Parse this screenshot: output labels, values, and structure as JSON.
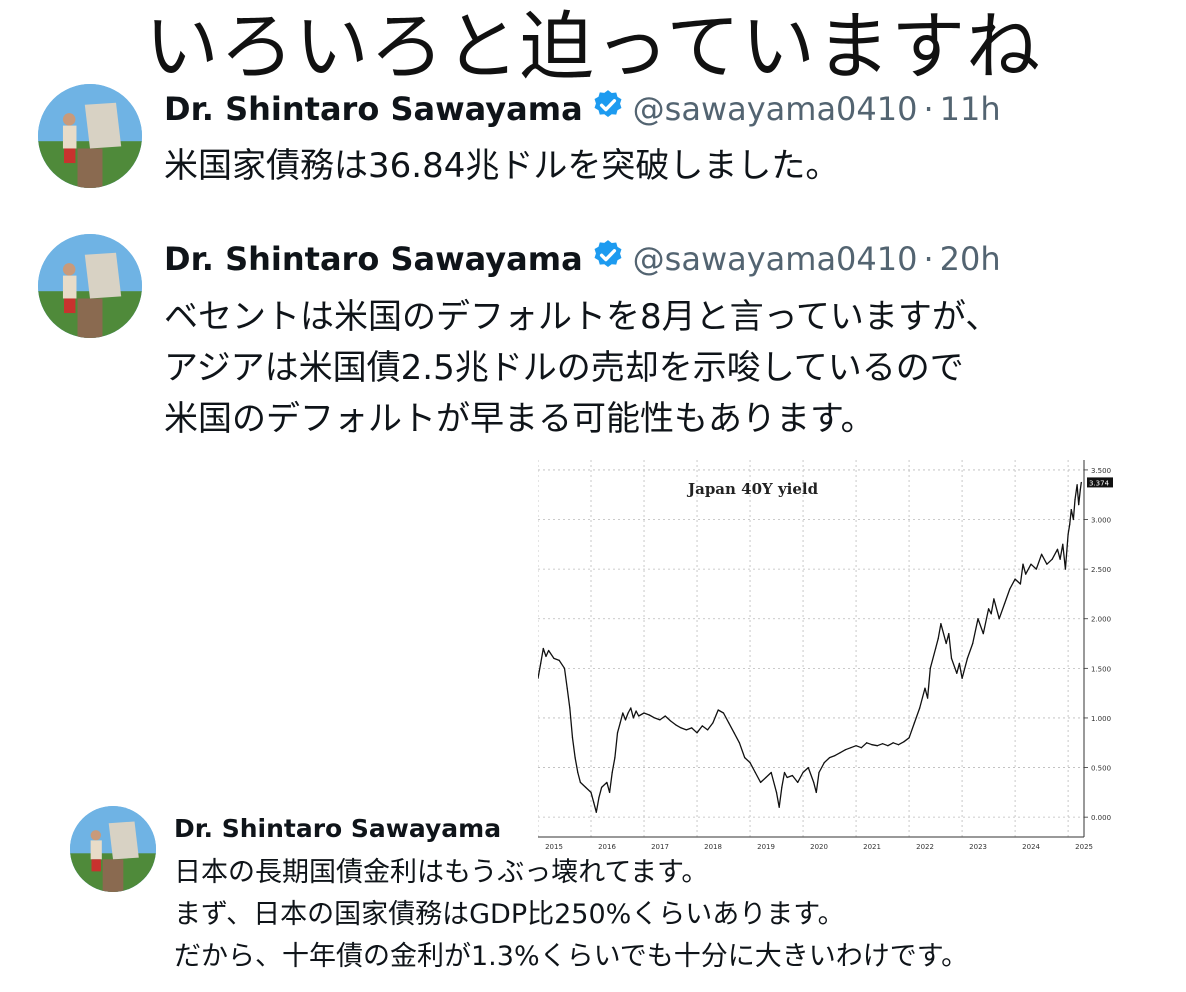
{
  "headline": "いろいろと迫っていますね",
  "tweets": [
    {
      "name": "Dr. Shintaro Sawayama",
      "handle": "@sawayama0410",
      "separator": "·",
      "time": "11h",
      "lines": [
        "米国家債務は36.84兆ドルを突破しました。"
      ]
    },
    {
      "name": "Dr. Shintaro Sawayama",
      "handle": "@sawayama0410",
      "separator": "·",
      "time": "20h",
      "lines": [
        "ベセントは米国のデフォルトを8月と言っていますが、",
        "アジアは米国債2.5兆ドルの売却を示唆しているので",
        "米国のデフォルトが早まる可能性もあります。"
      ]
    },
    {
      "name": "Dr. Shintaro Sawayama",
      "lines": [
        "日本の長期国債金利はもうぶっ壊れてます。",
        "まず、日本の国家債務はGDP比250%くらいあります。",
        "だから、十年債の金利が1.3%くらいでも十分に大きいわけです。"
      ]
    }
  ],
  "colors": {
    "verified": "#1d9bf0",
    "text": "#0f1419",
    "muted": "#536471",
    "line": "#111111"
  },
  "icons": {
    "verified": "verified-badge-icon",
    "avatar": "profile-photo"
  },
  "chart_data": {
    "type": "line",
    "title": "Japan 40Y yield",
    "xlabel": "",
    "ylabel": "",
    "x_ticks": [
      "2015",
      "2016",
      "2017",
      "2018",
      "2019",
      "2020",
      "2021",
      "2022",
      "2023",
      "2024",
      "2025"
    ],
    "y_ticks": [
      "0.000",
      "0.500",
      "1.000",
      "1.500",
      "2.000",
      "2.500",
      "3.000",
      "3.500"
    ],
    "ylim": [
      -0.2,
      3.6
    ],
    "xlim": [
      2015.0,
      2025.3
    ],
    "last_value_label": "3.374",
    "grid": true,
    "y_axis_side": "right",
    "series": [
      {
        "x": [
          2015.0,
          2015.05,
          2015.1,
          2015.15,
          2015.2,
          2015.3,
          2015.4,
          2015.5,
          2015.55,
          2015.6,
          2015.65,
          2015.7,
          2015.75,
          2015.8,
          2015.9,
          2016.0,
          2016.05,
          2016.1,
          2016.15,
          2016.2,
          2016.3,
          2016.35,
          2016.4,
          2016.45,
          2016.5,
          2016.55,
          2016.6,
          2016.65,
          2016.7,
          2016.75,
          2016.8,
          2016.85,
          2016.9,
          2017.0,
          2017.1,
          2017.2,
          2017.3,
          2017.4,
          2017.5,
          2017.6,
          2017.7,
          2017.8,
          2017.9,
          2018.0,
          2018.1,
          2018.2,
          2018.3,
          2018.4,
          2018.5,
          2018.6,
          2018.7,
          2018.8,
          2018.9,
          2019.0,
          2019.1,
          2019.2,
          2019.3,
          2019.4,
          2019.5,
          2019.55,
          2019.6,
          2019.65,
          2019.7,
          2019.8,
          2019.9,
          2020.0,
          2020.1,
          2020.2,
          2020.25,
          2020.3,
          2020.4,
          2020.5,
          2020.6,
          2020.7,
          2020.8,
          2020.9,
          2021.0,
          2021.1,
          2021.2,
          2021.3,
          2021.4,
          2021.5,
          2021.6,
          2021.7,
          2021.8,
          2021.9,
          2022.0,
          2022.1,
          2022.2,
          2022.3,
          2022.35,
          2022.4,
          2022.5,
          2022.55,
          2022.6,
          2022.7,
          2022.75,
          2022.8,
          2022.9,
          2022.95,
          2023.0,
          2023.1,
          2023.2,
          2023.3,
          2023.4,
          2023.5,
          2023.55,
          2023.6,
          2023.7,
          2023.8,
          2023.9,
          2024.0,
          2024.1,
          2024.15,
          2024.2,
          2024.3,
          2024.4,
          2024.5,
          2024.6,
          2024.7,
          2024.8,
          2024.85,
          2024.9,
          2024.95,
          2025.0,
          2025.03,
          2025.06,
          2025.1,
          2025.13,
          2025.17,
          2025.2,
          2025.23,
          2025.25
        ],
        "y": [
          1.4,
          1.55,
          1.7,
          1.62,
          1.68,
          1.6,
          1.58,
          1.5,
          1.3,
          1.1,
          0.8,
          0.6,
          0.45,
          0.35,
          0.3,
          0.25,
          0.15,
          0.05,
          0.2,
          0.3,
          0.35,
          0.25,
          0.45,
          0.6,
          0.85,
          0.95,
          1.05,
          0.98,
          1.05,
          1.1,
          1.0,
          1.07,
          1.02,
          1.05,
          1.03,
          1.0,
          0.98,
          1.02,
          0.97,
          0.93,
          0.9,
          0.88,
          0.9,
          0.85,
          0.92,
          0.88,
          0.95,
          1.08,
          1.05,
          0.95,
          0.85,
          0.75,
          0.6,
          0.55,
          0.45,
          0.35,
          0.4,
          0.45,
          0.25,
          0.1,
          0.3,
          0.45,
          0.4,
          0.42,
          0.35,
          0.45,
          0.5,
          0.35,
          0.25,
          0.45,
          0.55,
          0.6,
          0.62,
          0.65,
          0.68,
          0.7,
          0.72,
          0.7,
          0.75,
          0.73,
          0.72,
          0.74,
          0.72,
          0.75,
          0.73,
          0.76,
          0.8,
          0.95,
          1.1,
          1.3,
          1.2,
          1.5,
          1.7,
          1.8,
          1.95,
          1.75,
          1.85,
          1.6,
          1.45,
          1.55,
          1.4,
          1.6,
          1.75,
          2.0,
          1.85,
          2.1,
          2.05,
          2.2,
          2.0,
          2.15,
          2.3,
          2.4,
          2.35,
          2.55,
          2.45,
          2.55,
          2.5,
          2.65,
          2.55,
          2.6,
          2.7,
          2.6,
          2.75,
          2.5,
          2.85,
          2.95,
          3.1,
          3.0,
          3.2,
          3.35,
          3.15,
          3.3,
          3.374
        ]
      }
    ]
  }
}
